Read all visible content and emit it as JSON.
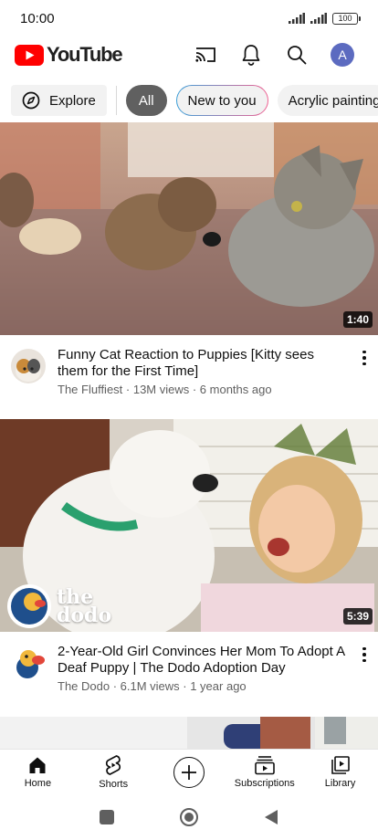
{
  "status_bar": {
    "time": "10:00",
    "battery": "100"
  },
  "app_bar": {
    "logo_text": "YouTube",
    "avatar_letter": "A"
  },
  "chips": [
    {
      "label": "Explore"
    },
    {
      "label": "All"
    },
    {
      "label": "New to you"
    },
    {
      "label": "Acrylic painting"
    }
  ],
  "videos": [
    {
      "title": "Funny Cat Reaction to Puppies [Kitty sees them for the First Time]",
      "channel": "The Fluffiest",
      "meta": "The Fluffiest · 13M views · 6 months ago",
      "duration": "1:40"
    },
    {
      "title": "2-Year-Old Girl Convinces Her Mom To Adopt A Deaf Puppy | The Dodo Adoption Day",
      "channel": "The Dodo",
      "meta": "The Dodo · 6.1M views · 1 year ago",
      "duration": "5:39",
      "watermark": "the dodo"
    }
  ],
  "bottom_nav": [
    {
      "label": "Home",
      "icon": "home-icon",
      "active": true
    },
    {
      "label": "Shorts",
      "icon": "shorts-icon"
    },
    {
      "label": "",
      "icon": "create-icon"
    },
    {
      "label": "Subscriptions",
      "icon": "subscriptions-icon"
    },
    {
      "label": "Library",
      "icon": "library-icon"
    }
  ],
  "colors": {
    "brand_red": "#ff0000",
    "chip_selected": "#606060",
    "avatar": "#5c6bc0"
  }
}
